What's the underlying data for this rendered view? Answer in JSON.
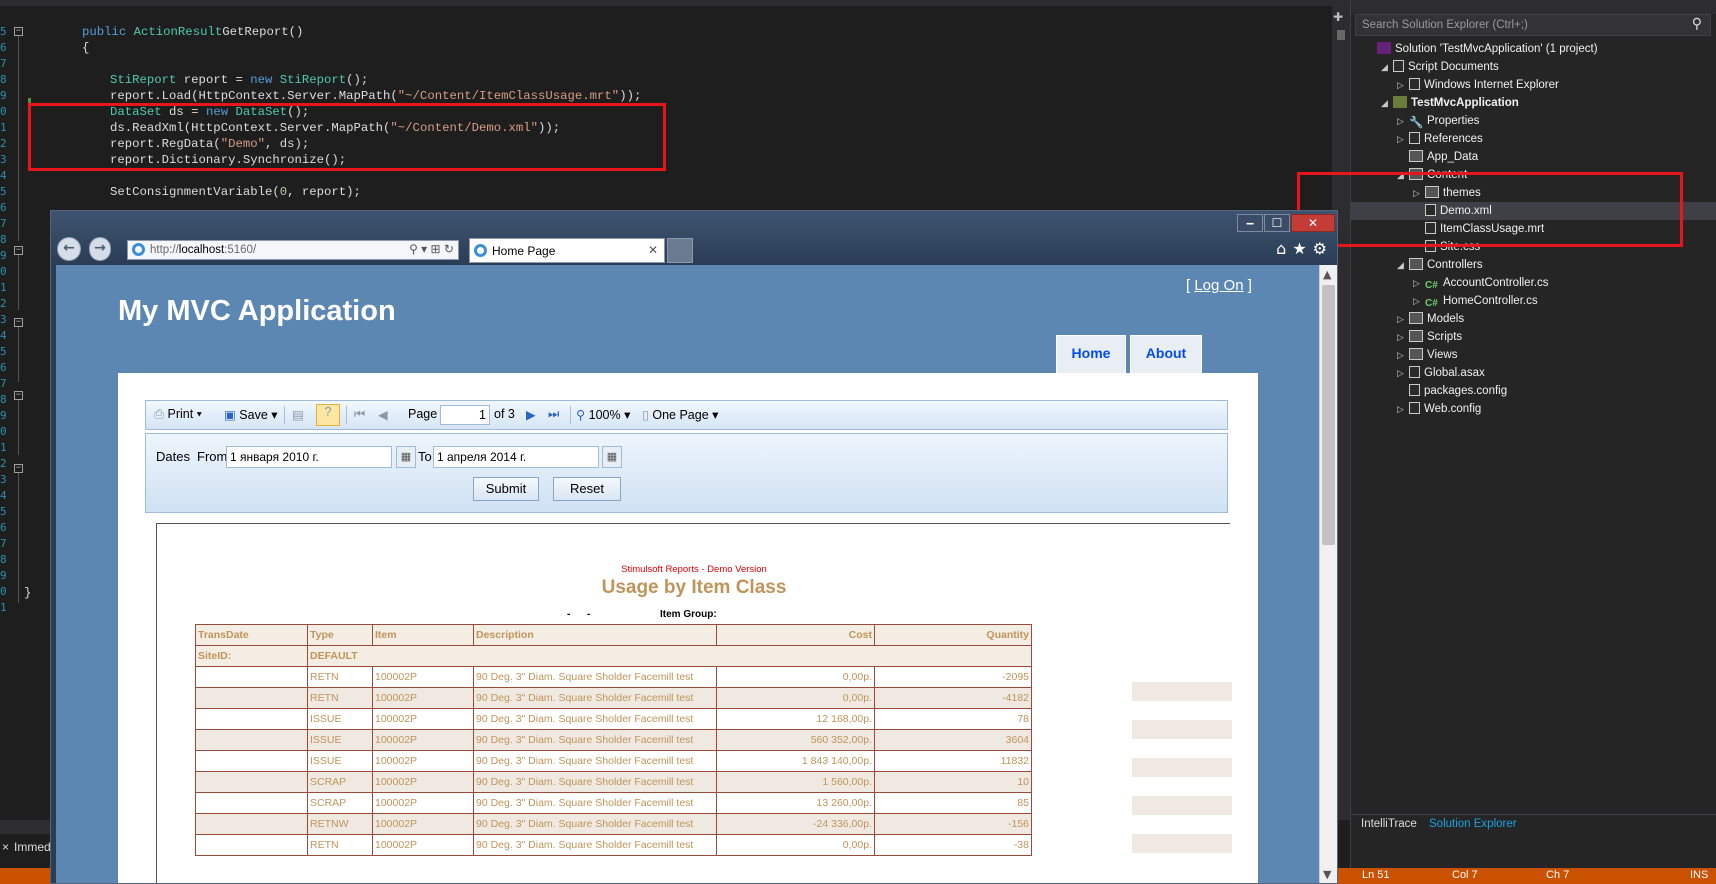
{
  "editor": {
    "line_numbers": [
      "5",
      "6",
      "7",
      "8",
      "9",
      "0",
      "1",
      "2",
      "3",
      "4",
      "5",
      "6",
      "7",
      "8",
      "9",
      "0",
      "1",
      "2",
      "3",
      "4",
      "5",
      "6",
      "7",
      "8",
      "9",
      "0",
      "1",
      "2",
      "3",
      "4",
      "5",
      "6",
      "7",
      "8",
      "9",
      "0",
      "1",
      "2",
      "3",
      "4"
    ],
    "code_lines": [
      {
        "segs": [
          [
            "kw",
            "public "
          ],
          [
            "ty",
            "ActionResult"
          ],
          [
            "",
            "GetReport()"
          ]
        ],
        "indent": 0
      },
      {
        "segs": [
          [
            "",
            "{"
          ]
        ],
        "indent": 0
      },
      {
        "segs": [],
        "indent": 0
      },
      {
        "segs": [
          [
            "ty",
            "StiReport"
          ],
          [
            "",
            " report = "
          ],
          [
            "kw",
            "new "
          ],
          [
            "ty",
            "StiReport"
          ],
          [
            "",
            "();"
          ]
        ],
        "indent": 1
      },
      {
        "segs": [
          [
            "",
            "report.Load(HttpContext.Server.MapPath("
          ],
          [
            "st",
            "\"~/Content/ItemClassUsage.mrt\""
          ],
          [
            "",
            "));"
          ]
        ],
        "indent": 1
      },
      {
        "segs": [
          [
            "ty",
            "DataSet"
          ],
          [
            "",
            " ds = "
          ],
          [
            "kw",
            "new "
          ],
          [
            "ty",
            "DataSet"
          ],
          [
            "",
            "();"
          ]
        ],
        "indent": 1
      },
      {
        "segs": [
          [
            "",
            "ds.ReadXml(HttpContext.Server.MapPath("
          ],
          [
            "st",
            "\"~/Content/Demo.xml\""
          ],
          [
            "",
            "));"
          ]
        ],
        "indent": 1
      },
      {
        "segs": [
          [
            "",
            "report.RegData("
          ],
          [
            "st",
            "\"Demo\""
          ],
          [
            "",
            ", ds);"
          ]
        ],
        "indent": 1
      },
      {
        "segs": [
          [
            "",
            "report.Dictionary.Synchronize();"
          ]
        ],
        "indent": 1
      },
      {
        "segs": [],
        "indent": 0
      },
      {
        "segs": [
          [
            "",
            "SetConsignmentVariable("
          ],
          [
            "nm",
            "0"
          ],
          [
            "",
            ", report);"
          ]
        ],
        "indent": 1
      }
    ],
    "closing_brace": "}",
    "bottom_tab": "Immed"
  },
  "statusbar": {
    "ln": "Ln 51",
    "col": "Col 7",
    "ch": "Ch 7",
    "ins": "INS"
  },
  "solution_explorer": {
    "search_placeholder": "Search Solution Explorer (Ctrl+;)",
    "items": [
      {
        "label": "Solution 'TestMvcApplication' (1 project)",
        "depth": 0,
        "arrow": "",
        "icon": "sln",
        "bold": false
      },
      {
        "label": "Script Documents",
        "depth": 1,
        "arrow": "◢",
        "icon": "file",
        "bold": false
      },
      {
        "label": "Windows Internet Explorer",
        "depth": 2,
        "arrow": "▷",
        "icon": "file",
        "bold": false
      },
      {
        "label": "TestMvcApplication",
        "depth": 1,
        "arrow": "◢",
        "icon": "proj",
        "bold": true
      },
      {
        "label": "Properties",
        "depth": 2,
        "arrow": "▷",
        "icon": "wrench",
        "bold": false
      },
      {
        "label": "References",
        "depth": 2,
        "arrow": "▷",
        "icon": "file",
        "bold": false
      },
      {
        "label": "App_Data",
        "depth": 2,
        "arrow": "",
        "icon": "folder",
        "bold": false
      },
      {
        "label": "Content",
        "depth": 2,
        "arrow": "◢",
        "icon": "folder",
        "bold": false
      },
      {
        "label": "themes",
        "depth": 3,
        "arrow": "▷",
        "icon": "folder",
        "bold": false
      },
      {
        "label": "Demo.xml",
        "depth": 3,
        "arrow": "",
        "icon": "file",
        "bold": false,
        "selected": true
      },
      {
        "label": "ItemClassUsage.mrt",
        "depth": 3,
        "arrow": "",
        "icon": "file",
        "bold": false
      },
      {
        "label": "Site.css",
        "depth": 3,
        "arrow": "",
        "icon": "file",
        "bold": false
      },
      {
        "label": "Controllers",
        "depth": 2,
        "arrow": "◢",
        "icon": "folder",
        "bold": false
      },
      {
        "label": "AccountController.cs",
        "depth": 3,
        "arrow": "▷",
        "icon": "cs",
        "bold": false
      },
      {
        "label": "HomeController.cs",
        "depth": 3,
        "arrow": "▷",
        "icon": "cs",
        "bold": false
      },
      {
        "label": "Models",
        "depth": 2,
        "arrow": "▷",
        "icon": "folder",
        "bold": false
      },
      {
        "label": "Scripts",
        "depth": 2,
        "arrow": "▷",
        "icon": "folder",
        "bold": false
      },
      {
        "label": "Views",
        "depth": 2,
        "arrow": "▷",
        "icon": "folder",
        "bold": false
      },
      {
        "label": "Global.asax",
        "depth": 2,
        "arrow": "▷",
        "icon": "file",
        "bold": false
      },
      {
        "label": "packages.config",
        "depth": 2,
        "arrow": "",
        "icon": "file",
        "bold": false
      },
      {
        "label": "Web.config",
        "depth": 2,
        "arrow": "▷",
        "icon": "file",
        "bold": false
      }
    ],
    "bottom_tabs": [
      "IntelliTrace",
      "Solution Explorer"
    ]
  },
  "browser": {
    "address_prefix": "http://",
    "address_host": "localhost",
    "address_port": ":5160/",
    "tab_title": "Home Page",
    "window_buttons": [
      "‒",
      "☐",
      "✕"
    ]
  },
  "site": {
    "title": "My MVC Application",
    "logon_open": "[ ",
    "logon_link": "Log On",
    "logon_close": " ]",
    "menu": [
      "Home",
      "About"
    ]
  },
  "viewer_toolbar": {
    "print": "Print",
    "save": "Save",
    "page_label": "Page",
    "page_value": "1",
    "page_of": "of 3",
    "zoom": "100%",
    "view_mode": "One Page"
  },
  "params": {
    "dates_label": "Dates",
    "from_label": "From",
    "from_value": "1 января 2010 г.",
    "to_label": "To",
    "to_value": "1 апреля 2014 г.",
    "submit": "Submit",
    "reset": "Reset"
  },
  "report": {
    "demo_notice": "Stimulsoft Reports - Demo Version",
    "title": "Usage by Item Class",
    "dash1": "-",
    "dash2": "-",
    "item_group_label": "Item Group:",
    "columns": [
      "TransDate",
      "Type",
      "Item",
      "Description",
      "Cost",
      "Quantity"
    ],
    "site_label": "SiteID:",
    "site_value": "DEFAULT",
    "rows": [
      {
        "date": "",
        "type": "RETN",
        "item": "100002P",
        "desc": "90 Deg. 3\" Diam. Square Sholder Facemill test",
        "cost": "0,00р.",
        "qty": "-2095"
      },
      {
        "date": "",
        "type": "RETN",
        "item": "100002P",
        "desc": "90 Deg. 3\" Diam. Square Sholder Facemill test",
        "cost": "0,00р.",
        "qty": "-4182"
      },
      {
        "date": "",
        "type": "ISSUE",
        "item": "100002P",
        "desc": "90 Deg. 3\" Diam. Square Sholder Facemill test",
        "cost": "12 168,00р.",
        "qty": "78"
      },
      {
        "date": "",
        "type": "ISSUE",
        "item": "100002P",
        "desc": "90 Deg. 3\" Diam. Square Sholder Facemill test",
        "cost": "560 352,00р.",
        "qty": "3604"
      },
      {
        "date": "",
        "type": "ISSUE",
        "item": "100002P",
        "desc": "90 Deg. 3\" Diam. Square Sholder Facemill test",
        "cost": "1 843 140,00р.",
        "qty": "11832"
      },
      {
        "date": "",
        "type": "SCRAP",
        "item": "100002P",
        "desc": "90 Deg. 3\" Diam. Square Sholder Facemill test",
        "cost": "1 560,00р.",
        "qty": "10"
      },
      {
        "date": "",
        "type": "SCRAP",
        "item": "100002P",
        "desc": "90 Deg. 3\" Diam. Square Sholder Facemill test",
        "cost": "13 260,00р.",
        "qty": "85"
      },
      {
        "date": "",
        "type": "RETNW",
        "item": "100002P",
        "desc": "90 Deg. 3\" Diam. Square Sholder Facemill test",
        "cost": "-24 336,00р.",
        "qty": "-156"
      },
      {
        "date": "",
        "type": "RETN",
        "item": "100002P",
        "desc": "90 Deg. 3\" Diam. Square Sholder Facemill test",
        "cost": "0,00р.",
        "qty": "-38"
      }
    ]
  },
  "colors": {
    "highlight_box": "#e8151b",
    "statusbar": "#ca5100",
    "site_background": "#5c87b2",
    "report_text": "#c0945a"
  }
}
